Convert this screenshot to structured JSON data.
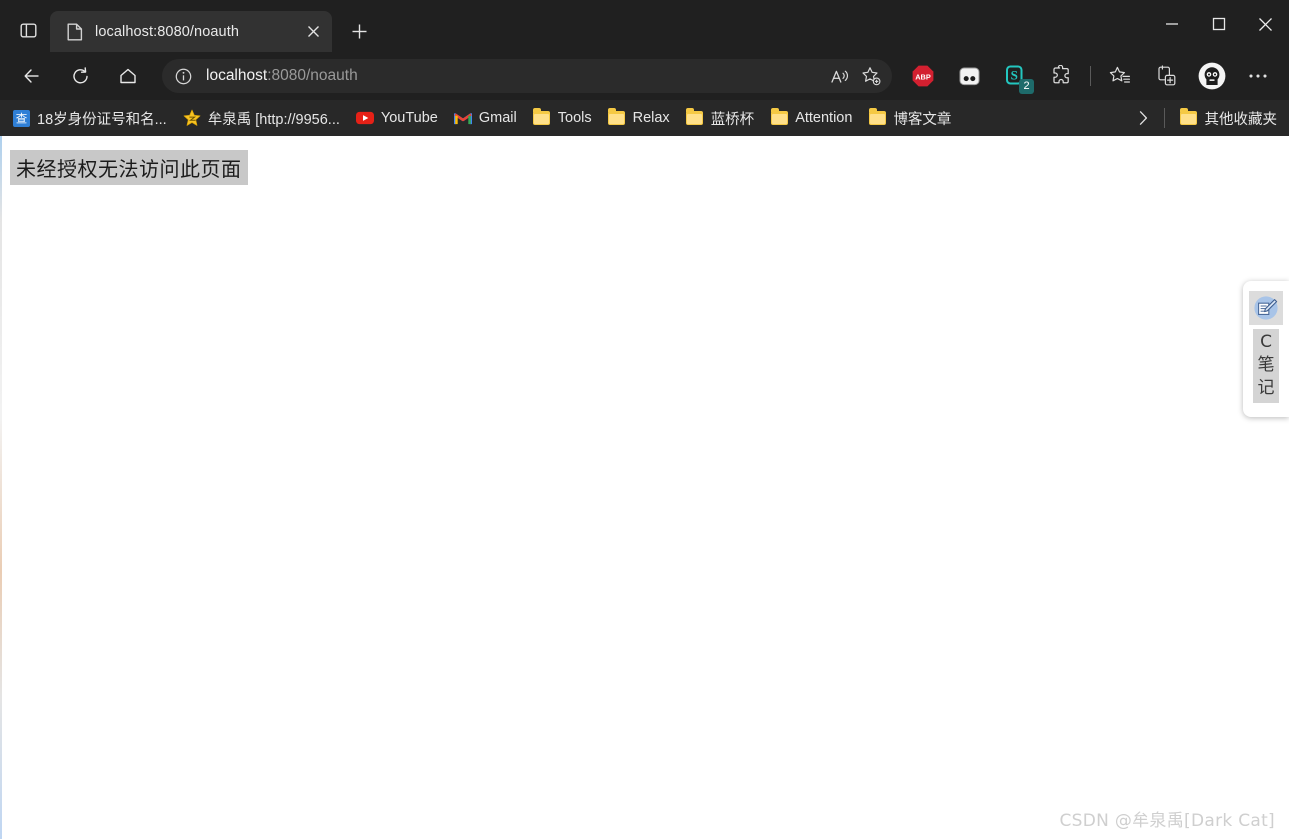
{
  "window": {
    "minimize_label": "Minimize",
    "maximize_label": "Maximize",
    "close_label": "Close"
  },
  "tabstrip": {
    "tab_search_label": "Tab actions menu",
    "new_tab_label": "New tab",
    "tabs": [
      {
        "title": "localhost:8080/noauth",
        "favicon": "page-icon",
        "close_label": "Close tab"
      }
    ]
  },
  "toolbar": {
    "back_label": "Back",
    "refresh_label": "Refresh",
    "home_label": "Home",
    "url_host": "localhost",
    "url_rest": ":8080/noauth",
    "url_full": "localhost:8080/noauth",
    "site_info_label": "View site information",
    "read_aloud_label": "Read this page aloud",
    "add_favorite_label": "Add this page to favorites",
    "extensions": [
      {
        "name": "adblock-plus-icon",
        "label": "ABP"
      },
      {
        "name": "tampermonkey-icon",
        "label": ""
      },
      {
        "name": "s-extension-icon",
        "label": "S",
        "badge": "2"
      },
      {
        "name": "browser-extensions-icon",
        "label": ""
      }
    ],
    "favorites_label": "Favorites",
    "collections_label": "Collections",
    "profile_label": "Profile",
    "settings_label": "Settings and more"
  },
  "bookmarks": {
    "items": [
      {
        "label": "18岁身份证号和名...",
        "icon": "cha-site-icon"
      },
      {
        "label": "牟泉禹 [http://9956...",
        "icon": "star-icon"
      },
      {
        "label": "YouTube",
        "icon": "youtube-icon"
      },
      {
        "label": "Gmail",
        "icon": "gmail-icon"
      },
      {
        "label": "Tools",
        "icon": "folder-icon"
      },
      {
        "label": "Relax",
        "icon": "folder-icon"
      },
      {
        "label": "蓝桥杯",
        "icon": "folder-icon"
      },
      {
        "label": "Attention",
        "icon": "folder-icon"
      },
      {
        "label": "博客文章",
        "icon": "folder-icon"
      }
    ],
    "overflow_label": "Show more bookmarks",
    "other_favorites": {
      "label": "其他收藏夹",
      "icon": "folder-icon"
    }
  },
  "page": {
    "body_text": "未经授权无法访问此页面",
    "watermark": "CSDN @牟泉禹[Dark Cat]"
  },
  "note_widget": {
    "icon": "note-pen-icon",
    "lines": [
      "C",
      "笔",
      "记"
    ]
  },
  "colors": {
    "chrome_bg": "#202020",
    "tab_active_bg": "#323232",
    "omnibox_bg": "#2b2b2b",
    "bookmarks_bg": "#282828",
    "page_bg": "#ffffff",
    "selection_gray": "#c8c8c8",
    "folder_yellow": "#f5c944",
    "abp_red": "#d32030",
    "badge_teal": "#1e6b6b"
  }
}
